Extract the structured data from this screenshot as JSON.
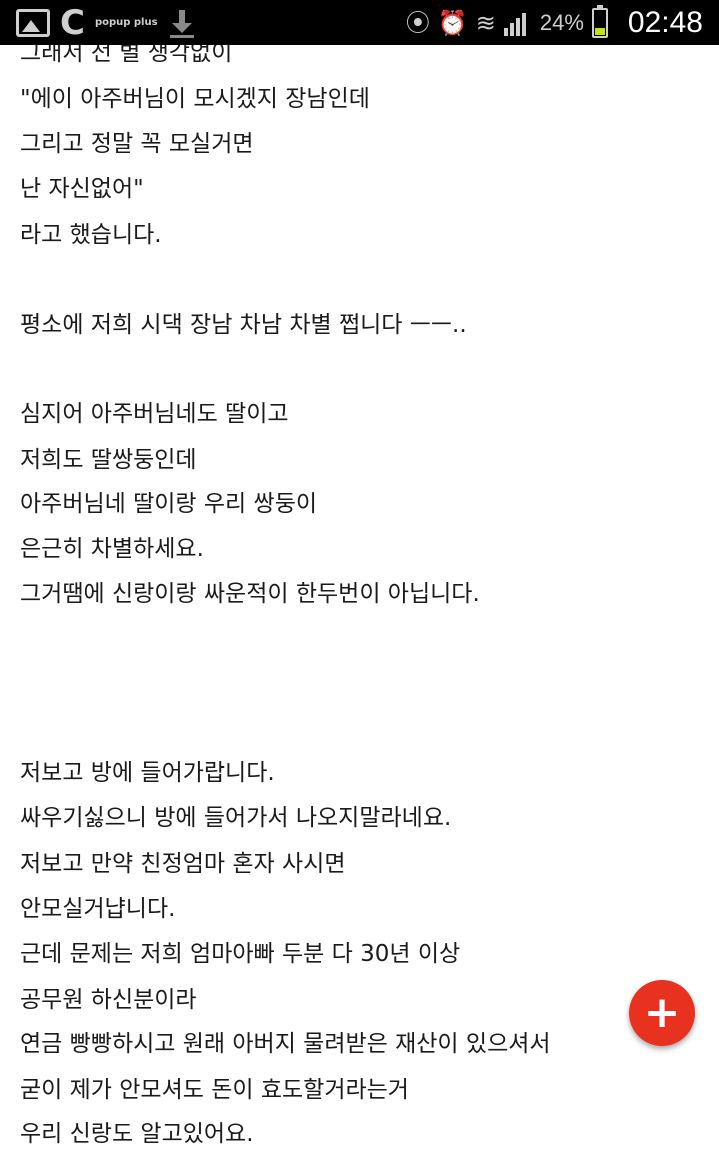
{
  "status_bar": {
    "app_icons": [
      "gallery-icon",
      "c-icon",
      "popup-plus-icon",
      "download-icon"
    ],
    "popup_label": "popup plus",
    "battery_percent": "24%",
    "battery_level": 0.24,
    "time": "02:48"
  },
  "post_body": {
    "lines": [
      "그래서 전 별 생각없이",
      "\"에이 아주버님이 모시겠지 장남인데",
      "그리고 정말 꼭 모실거면",
      "난 자신없어\"",
      "라고 했습니다.",
      "평소에 저희 시댁 장남 차남 차별 쩝니다 ㅡㅡ..",
      "심지어 아주버님네도 딸이고",
      "저희도 딸쌍둥인데",
      "아주버님네 딸이랑 우리 쌍둥이",
      "은근히 차별하세요.",
      "그거땜에 신랑이랑 싸운적이 한두번이 아닙니다.",
      "저보고 방에 들어가랍니다.",
      "싸우기싫으니 방에 들어가서 나오지말라네요.",
      "저보고 만약 친정엄마 혼자 사시면",
      "안모실거냡니다.",
      "근데 문제는 저희 엄마아빠 두분 다 30년 이상",
      "공무원 하신분이라",
      "연금 빵빵하시고 원래 아버지 물려받은 재산이 있으셔서",
      "굳이 제가 안모셔도 돈이 효도할거라는거",
      "우리 신랑도 알고있어요."
    ]
  },
  "fab": {
    "label": "+"
  }
}
